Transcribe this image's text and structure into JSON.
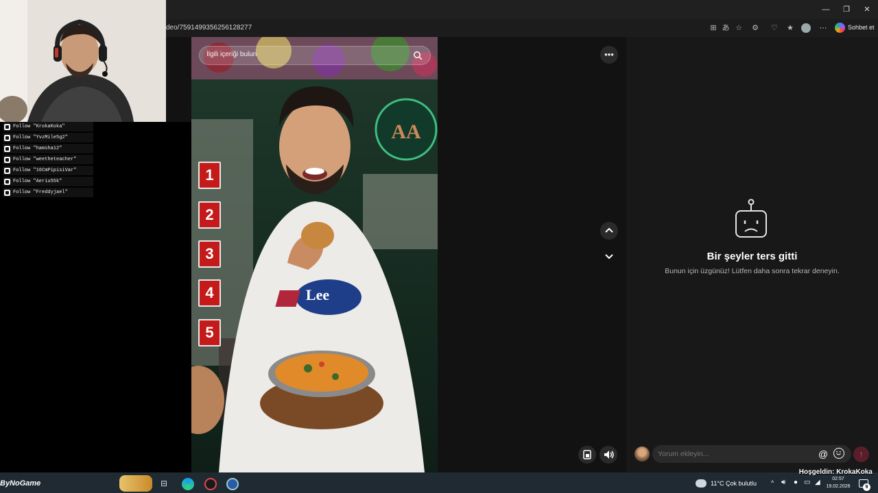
{
  "browser": {
    "url": "deo/7591499356256128277",
    "chat_button_label": "Sohbet et",
    "window_controls": [
      "—",
      "❐",
      "✕"
    ]
  },
  "webcam": {
    "icon": "streamer-webcam"
  },
  "follow_list": [
    "Follow \"KrokaKoka\"",
    "Follow \"YvzMile5g2\"",
    "Follow \"hamsha12\"",
    "Follow \"weetheteacher\"",
    "Follow \"16CmPipisiVar\"",
    "Follow \"Aeriu55k\"",
    "Follow \"Freddyjael\""
  ],
  "video": {
    "search_placeholder": "İlgili içeriği bulun",
    "numbers": [
      "1",
      "2",
      "3",
      "4",
      "5"
    ],
    "shirt_text": "Lee"
  },
  "panel": {
    "error_title": "Bir şeyler ters gitti",
    "error_description": "Bunun için üzgünüz! Lütfen daha sonra tekrar deneyin.",
    "comment_placeholder": "Yorum ekleyin..."
  },
  "taskbar": {
    "logo_text": "ByNoGame",
    "welcome": "Hoşgeldin: KrokaKoka",
    "weather": "11°C  Çok bulutlu",
    "time": "02:57",
    "date": "19.02.2026",
    "notification_count": "9"
  },
  "colors": {
    "accent_red": "#c41a1a",
    "panel_bg": "#181818",
    "send_button": "#5a1d2a"
  }
}
